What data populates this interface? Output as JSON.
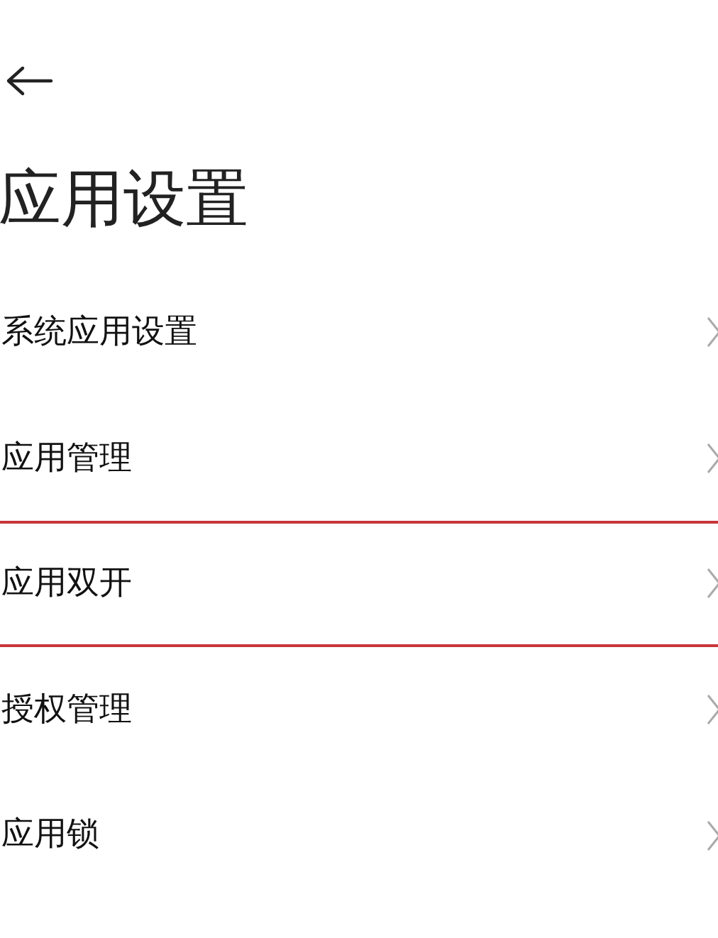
{
  "title": "应用设置",
  "items": [
    {
      "label": "系统应用设置",
      "highlighted": false
    },
    {
      "label": "应用管理",
      "highlighted": false
    },
    {
      "label": "应用双开",
      "highlighted": true
    },
    {
      "label": "授权管理",
      "highlighted": false
    },
    {
      "label": "应用锁",
      "highlighted": false
    }
  ]
}
